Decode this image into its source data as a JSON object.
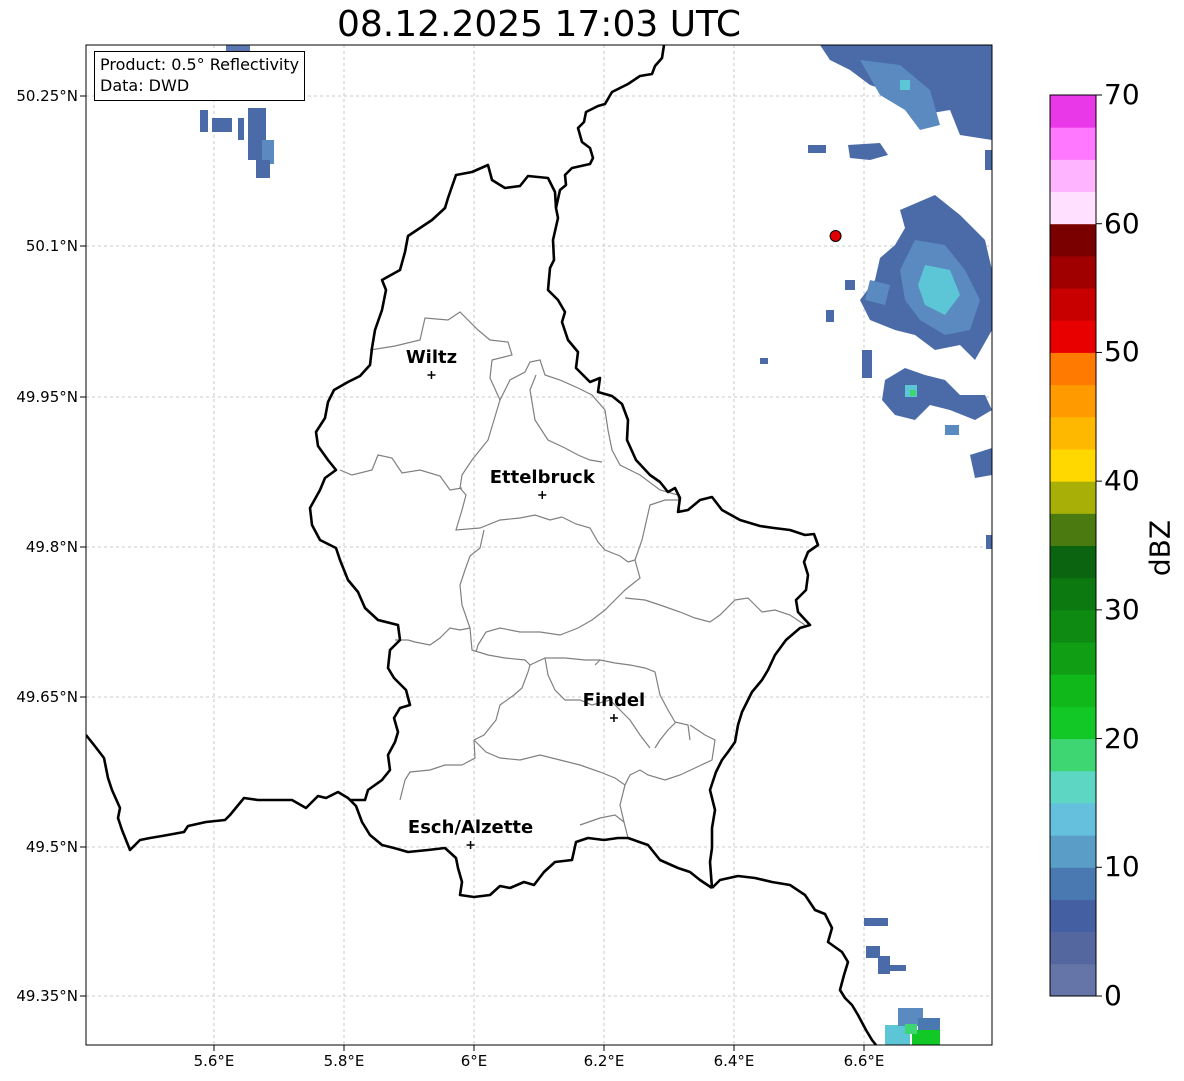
{
  "title": "08.12.2025 17:03 UTC",
  "info_box": {
    "product": "Product: 0.5° Reflectivity",
    "data_source": "Data: DWD"
  },
  "lat_labels": [
    "50.25°N",
    "50.1°N",
    "49.95°N",
    "49.8°N",
    "49.65°N",
    "49.5°N",
    "49.35°N"
  ],
  "lon_labels": [
    "5.6°E",
    "5.8°E",
    "6°E",
    "6.2°E",
    "6.4°E",
    "6.6°E"
  ],
  "cities": [
    {
      "name": "Wiltz",
      "lon": 5.93,
      "lat": 49.97
    },
    {
      "name": "Ettelbruck",
      "lon": 6.1,
      "lat": 49.85
    },
    {
      "name": "Findel",
      "lon": 6.21,
      "lat": 49.627
    },
    {
      "name": "Esch/Alzette",
      "lon": 5.99,
      "lat": 49.5
    }
  ],
  "radar_site": {
    "lon": 6.55,
    "lat": 50.109,
    "color": "#e00000"
  },
  "map_extent": {
    "lon_min": 5.4,
    "lon_max": 6.79,
    "lat_min": 49.3,
    "lat_max": 50.3
  },
  "colorbar": {
    "label": "dBZ",
    "ticks": [
      "0",
      "10",
      "20",
      "30",
      "40",
      "50",
      "60",
      "70"
    ],
    "colors": [
      "#6575a8",
      "#54679f",
      "#4560a2",
      "#4a78b0",
      "#5a9ec8",
      "#64c0dc",
      "#5ed6c4",
      "#3ed672",
      "#12c827",
      "#10b81a",
      "#109e14",
      "#0e8a12",
      "#0c7810",
      "#0a6410",
      "#4a7a10",
      "#a8b008",
      "#ffd800",
      "#ffb800",
      "#ff9a00",
      "#ff7a00",
      "#e80000",
      "#c80000",
      "#a00000",
      "#7a0000",
      "#ffe0ff",
      "#ffb4ff",
      "#ff78ff",
      "#e838e8"
    ]
  },
  "echo_colors": {
    "low": "#4a6aa8",
    "mid": "#5b8ac0",
    "high": "#5cc6d6",
    "strong": "#12c827"
  }
}
